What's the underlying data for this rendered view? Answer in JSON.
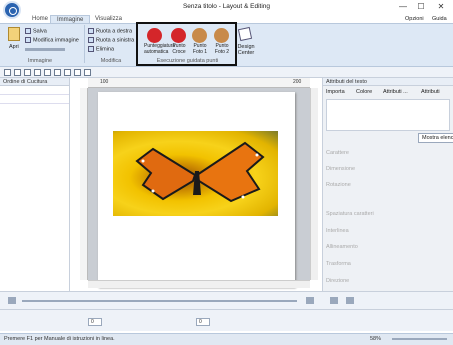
{
  "window": {
    "title": "Senza titolo - Layout & Editing",
    "minimize": "—",
    "maximize": "☐",
    "close": "✕"
  },
  "tabs": [
    "Home",
    "Immagine",
    "Visualizza"
  ],
  "right_menu": {
    "options": "Opzioni",
    "guide": "Guida"
  },
  "ribbon": {
    "open": "Apri",
    "save": "Salva",
    "edit_image": "Modifica immagine",
    "group_image": "Immagine",
    "rotate_right": "Ruota a destra",
    "rotate_left": "Ruota a sinistra",
    "delete": "Elimina",
    "group_edit": "Modifica",
    "stamps": [
      {
        "label": "Punteggiatura automatica",
        "color": "#d4262a"
      },
      {
        "label": "Punto Croce",
        "color": "#d4262a"
      },
      {
        "label": "Punto Foto 1",
        "color": "#c88a4a"
      },
      {
        "label": "Punto Foto 2",
        "color": "#c88a4a"
      }
    ],
    "design_center": "Design Center",
    "group_guided": "Esecuzione guidata punti"
  },
  "left_panel": {
    "title": "Ordine di Cucitura"
  },
  "right_panel": {
    "title": "Attributi del testo",
    "tabs": [
      "Importa",
      "Colore",
      "Attributi ...",
      "Attributi"
    ],
    "show_list": "Mostra elenco",
    "rows": [
      "Carattere",
      "Dimensione",
      "Rotazione",
      "Spaziatura caratteri",
      "Interlinea",
      "Allineamento",
      "Trasforma",
      "Direzione"
    ]
  },
  "ruler": {
    "labels": [
      "100",
      "200"
    ]
  },
  "status": {
    "text": "Premere F1 per Manuale di istruzioni in linea.",
    "zoom": "58%"
  },
  "bottom": {
    "value": "0"
  }
}
